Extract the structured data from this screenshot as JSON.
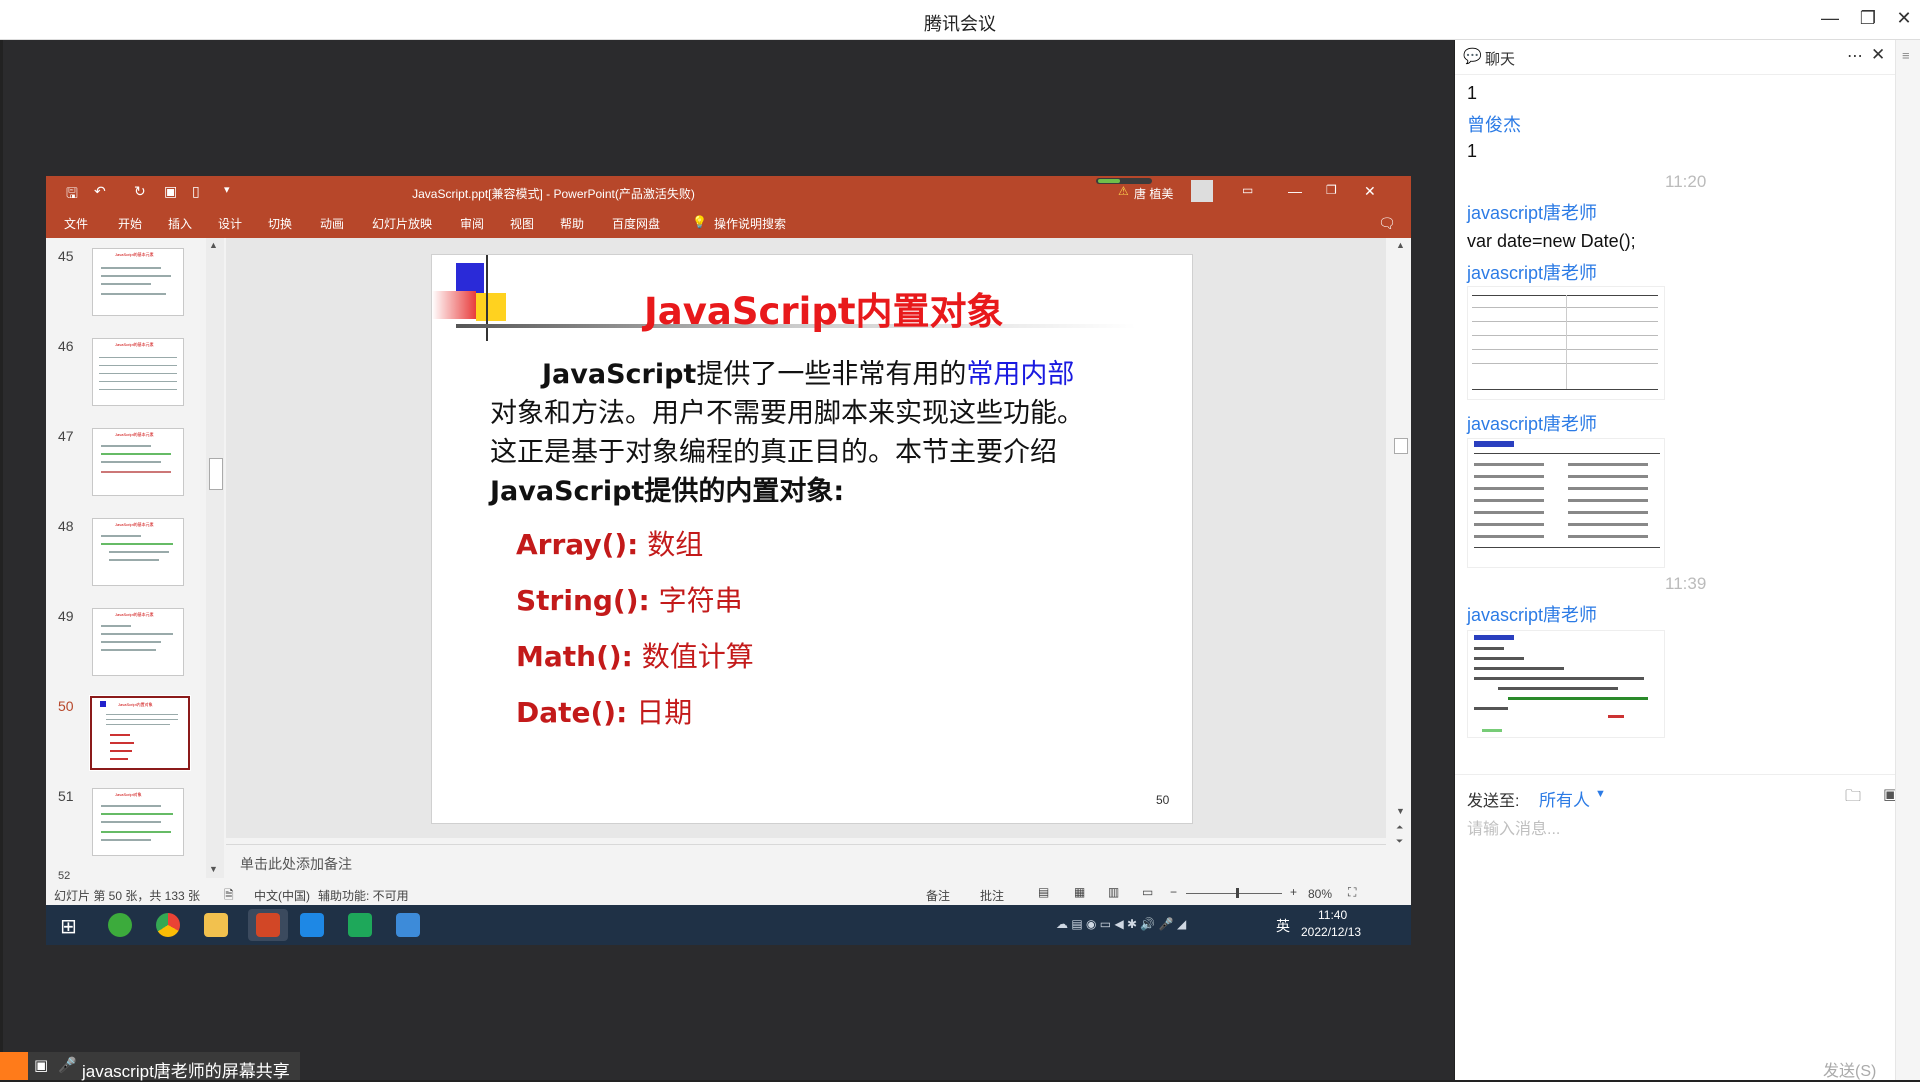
{
  "app": {
    "title": "腾讯会议"
  },
  "share_label": "javascript唐老师的屏幕共享",
  "ppt": {
    "window_title": "JavaScript.ppt[兼容模式] - PowerPoint(产品激活失败)",
    "user_name": "唐 植美",
    "ribbon_tabs": [
      "文件",
      "开始",
      "插入",
      "设计",
      "切换",
      "动画",
      "幻灯片放映",
      "审阅",
      "视图",
      "帮助",
      "百度网盘"
    ],
    "search_hint": "操作说明搜索",
    "thumbnails": [
      {
        "num": "45",
        "label": "JavaScript的基本元素"
      },
      {
        "num": "46",
        "label": "JavaScript的基本元素"
      },
      {
        "num": "47",
        "label": "JavaScript的基本元素"
      },
      {
        "num": "48",
        "label": "JavaScript的基本元素"
      },
      {
        "num": "49",
        "label": "JavaScript的基本元素"
      },
      {
        "num": "50",
        "label": "JavaScript内置对象"
      },
      {
        "num": "51",
        "label": "JavaScript对象"
      }
    ],
    "thumb_next_num": "52",
    "notes_placeholder": "单击此处添加备注",
    "status": {
      "slide_info": "幻灯片 第 50 张，共 133 张",
      "language": "中文(中国)",
      "accessibility": "辅助功能: 不可用",
      "notes_btn": "备注",
      "comments_btn": "批注",
      "zoom": "80%"
    },
    "slide": {
      "title": "JavaScript内置对象",
      "para": {
        "l1_bold": "JavaScript",
        "l1_text": "提供了一些非常有用的",
        "l1_blue": "常用内部",
        "l2": "对象和方法。用户不需要用脚本来实现这些功能。",
        "l3": "这正是基于对象编程的真正目的。本节主要介绍",
        "l4_bold": "JavaScript",
        "l4_text": "提供的内置对象:"
      },
      "items": [
        {
          "name": "Array():",
          "desc": " 数组"
        },
        {
          "name": "String():",
          "desc": " 字符串"
        },
        {
          "name": "Math():",
          "desc": " 数值计算"
        },
        {
          "name": "Date():",
          "desc": " 日期"
        }
      ],
      "page_num": "50"
    },
    "taskbar": {
      "time": "11:40",
      "date": "2022/12/13",
      "ime": "英"
    }
  },
  "chat": {
    "title": "聊天",
    "messages": [
      {
        "type": "text",
        "text": "1"
      },
      {
        "type": "name",
        "text": "曾俊杰"
      },
      {
        "type": "text",
        "text": "1"
      },
      {
        "type": "time",
        "text": "11:20"
      },
      {
        "type": "name",
        "text": "javascript唐老师"
      },
      {
        "type": "text",
        "text": "var date=new Date();"
      },
      {
        "type": "name",
        "text": "javascript唐老师"
      },
      {
        "type": "name",
        "text": "javascript唐老师"
      },
      {
        "type": "time",
        "text": "11:39"
      },
      {
        "type": "name",
        "text": "javascript唐老师"
      }
    ],
    "send_to_label": "发送至:",
    "send_to_value": "所有人",
    "input_placeholder": "请输入消息...",
    "send_button": "发送(S)"
  }
}
